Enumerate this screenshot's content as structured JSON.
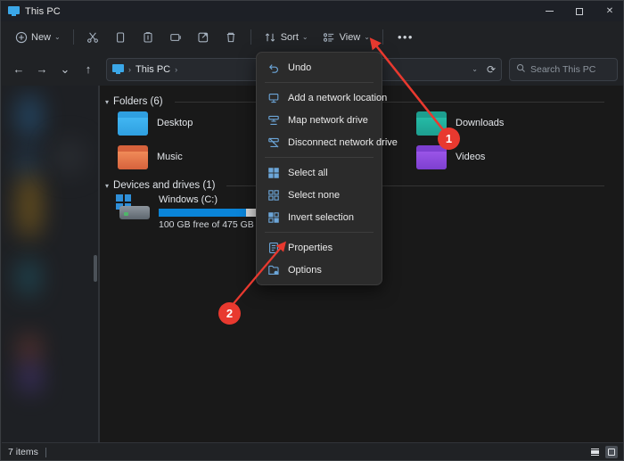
{
  "window": {
    "title": "This PC",
    "title_icon": "monitor-icon",
    "controls": {
      "minimize": "minimize-icon",
      "maximize": "maximize-icon",
      "close": "✕"
    }
  },
  "toolbar": {
    "new_label": "New",
    "new_icon": "plus-circle-icon",
    "chevron": "⌄",
    "actions": [
      {
        "name": "cut",
        "icon": "scissors-icon"
      },
      {
        "name": "copy",
        "icon": "copy-icon"
      },
      {
        "name": "paste",
        "icon": "paste-icon"
      },
      {
        "name": "rename",
        "icon": "rename-icon"
      },
      {
        "name": "share",
        "icon": "share-icon"
      },
      {
        "name": "delete",
        "icon": "trash-icon"
      }
    ],
    "sort_label": "Sort",
    "sort_icon": "sort-arrows-icon",
    "view_label": "View",
    "view_icon": "view-list-icon",
    "more_label": "•••"
  },
  "address": {
    "back_icon": "←",
    "forward_icon": "→",
    "recent_icon": "⌄",
    "up_icon": "↑",
    "breadcrumb_icon": "monitor-icon",
    "breadcrumb_text": "This PC",
    "separator": "›",
    "dropdown_icon": "⌄",
    "refresh_icon": "⟳"
  },
  "search": {
    "icon": "search-icon",
    "placeholder": "Search This PC"
  },
  "content": {
    "groups": [
      {
        "label": "Folders (6)"
      },
      {
        "label": "Devices and drives (1)"
      }
    ],
    "folders": [
      {
        "name": "Desktop",
        "icon": "folder-icon",
        "color_back": "#2f9fe0",
        "color_front": "#38b6f0"
      },
      {
        "name": "Music",
        "icon": "folder-icon",
        "color_back": "#d6623c",
        "color_front": "#ef8050"
      },
      {
        "name": "Downloads",
        "icon": "folder-icon",
        "color_back": "#1d9e8f",
        "color_front": "#23b5a2"
      },
      {
        "name": "Videos",
        "icon": "folder-icon",
        "color_back": "#7d3fd0",
        "color_front": "#9a55e8"
      }
    ],
    "drive": {
      "name": "Windows (C:)",
      "icon": "drive-icon",
      "free_text": "100 GB free of 475 GB",
      "used_percent": 79,
      "bar_color": "#0a84d8",
      "track_color": "#d8d8d8"
    }
  },
  "menu": {
    "items": [
      {
        "label": "Undo",
        "icon": "undo-icon",
        "divider_after": true
      },
      {
        "label": "Add a network location",
        "icon": "network-location-icon",
        "divider_after": false
      },
      {
        "label": "Map network drive",
        "icon": "map-drive-icon",
        "divider_after": false
      },
      {
        "label": "Disconnect network drive",
        "icon": "disconnect-drive-icon",
        "divider_after": true
      },
      {
        "label": "Select all",
        "icon": "select-all-icon",
        "divider_after": false
      },
      {
        "label": "Select none",
        "icon": "select-none-icon",
        "divider_after": false
      },
      {
        "label": "Invert selection",
        "icon": "invert-selection-icon",
        "divider_after": true
      },
      {
        "label": "Properties",
        "icon": "properties-icon",
        "divider_after": false
      },
      {
        "label": "Options",
        "icon": "options-icon",
        "divider_after": false
      }
    ]
  },
  "annotations": {
    "color": "#e8392f",
    "markers": [
      {
        "label": "1"
      },
      {
        "label": "2"
      }
    ]
  },
  "statusbar": {
    "items_text": "7 items",
    "view_details_icon": "details-view-icon",
    "view_large_icon": "large-icons-view-icon"
  }
}
